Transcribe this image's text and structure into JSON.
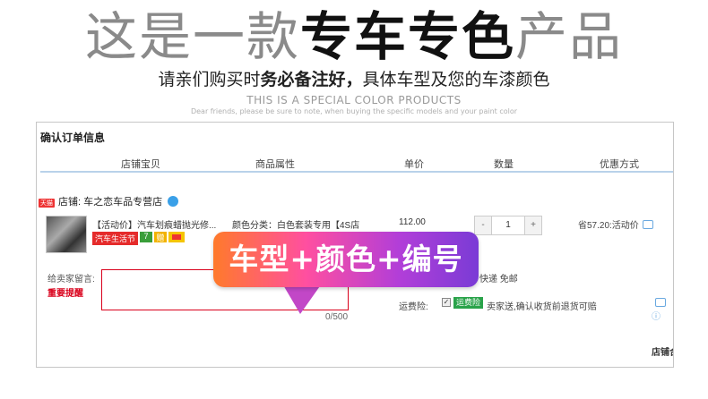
{
  "hero": {
    "title_light_1": "这是一款",
    "title_bold": "专车专色",
    "title_light_2": "产品",
    "subtitle_1": "请亲们购买时",
    "subtitle_bold": "务必备注好，",
    "subtitle_2": "具体车型及您的车漆颜色",
    "english": "THIS IS A SPECIAL COLOR PRODUCTS",
    "english_small": "Dear friends, please be sure to note, when buying the specific models and your paint color"
  },
  "order": {
    "title": "确认订单信息",
    "columns": [
      "店铺宝贝",
      "商品属性",
      "单价",
      "数量",
      "优惠方式"
    ],
    "shop_tag": "天猫",
    "shop_name": "店铺: 车之恋车品专营店",
    "product_name": "【活动价】汽车划痕蜡抛光修...",
    "badge_text": "汽车生活节",
    "badge_g": "7",
    "badge_y": "赠",
    "attribute": "颜色分类：白色套装专用【4S店",
    "price": "112.00",
    "qty_minus": "-",
    "qty_value": "1",
    "qty_plus": "+",
    "discount": "省57.20:活动价",
    "message_label": "给卖家留言:",
    "message_warning": "重要提醒",
    "message_count": "0/500",
    "shipping": "快递 免邮",
    "insurance_label": "运费险:",
    "insurance_check": "✓",
    "insurance_badge": "运费险",
    "insurance_text": "卖家送,确认收货前退货可赔",
    "shop_total": "店铺合"
  },
  "overlay": {
    "text": "车型+颜色+编号"
  },
  "colors": {
    "accent_red": "#d9001b",
    "header_line": "#b9d2ea",
    "overlay_start": "#ff7a2b",
    "overlay_end": "#7a3bd6"
  }
}
